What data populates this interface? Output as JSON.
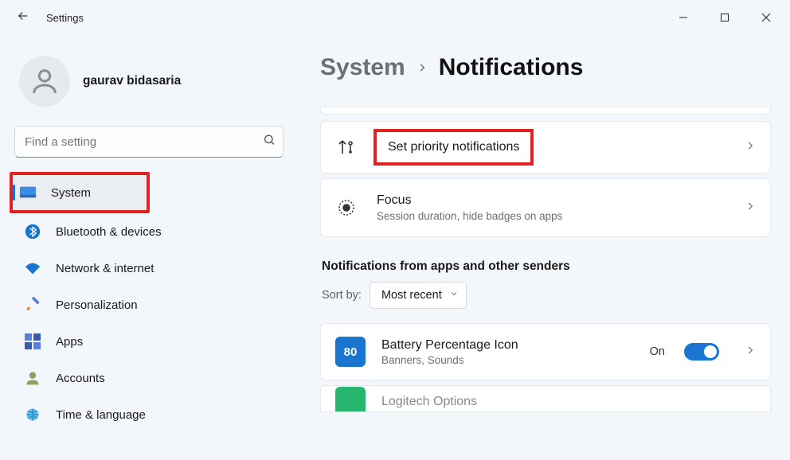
{
  "titlebar": {
    "title": "Settings"
  },
  "account": {
    "name": "gaurav bidasaria"
  },
  "search": {
    "placeholder": "Find a setting"
  },
  "sidebar": {
    "items": [
      {
        "label": "System",
        "active": true,
        "highlighted": true
      },
      {
        "label": "Bluetooth & devices"
      },
      {
        "label": "Network & internet"
      },
      {
        "label": "Personalization"
      },
      {
        "label": "Apps"
      },
      {
        "label": "Accounts"
      },
      {
        "label": "Time & language"
      }
    ]
  },
  "breadcrumb": {
    "parent": "System",
    "current": "Notifications"
  },
  "cards": {
    "priority": {
      "title": "Set priority notifications"
    },
    "focus": {
      "title": "Focus",
      "sub": "Session duration, hide badges on apps"
    }
  },
  "section_title": "Notifications from apps and other senders",
  "sort": {
    "label": "Sort by:",
    "selected": "Most recent"
  },
  "apps": [
    {
      "title": "Battery Percentage Icon",
      "sub": "Banners, Sounds",
      "state_label": "On",
      "icon_text": "80",
      "icon_bg": "#1975d0",
      "icon_color": "#ffffff"
    },
    {
      "title": "Logitech Options",
      "icon_bg": "#27b66e"
    }
  ]
}
